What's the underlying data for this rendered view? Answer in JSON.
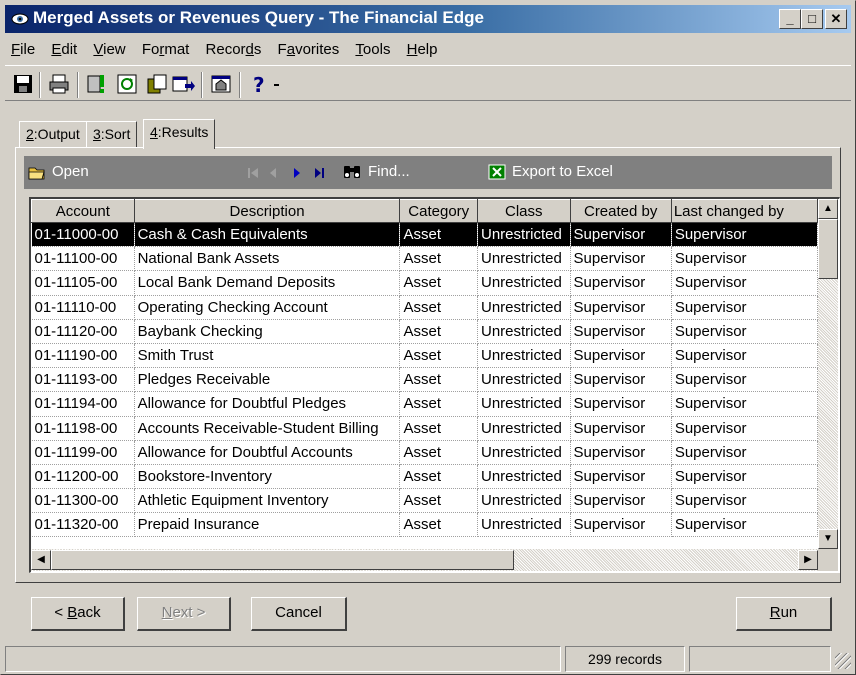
{
  "window": {
    "title": "Merged Assets or Revenues Query - The Financial Edge"
  },
  "menu": [
    {
      "pre": "",
      "u": "F",
      "post": "ile"
    },
    {
      "pre": "",
      "u": "E",
      "post": "dit"
    },
    {
      "pre": "",
      "u": "V",
      "post": "iew"
    },
    {
      "pre": "Fo",
      "u": "r",
      "post": "mat"
    },
    {
      "pre": "Recor",
      "u": "d",
      "post": "s"
    },
    {
      "pre": "F",
      "u": "a",
      "post": "vorites"
    },
    {
      "pre": "",
      "u": "T",
      "post": "ools"
    },
    {
      "pre": "",
      "u": "H",
      "post": "elp"
    }
  ],
  "tabs": [
    {
      "num": "2",
      "label": ":Output"
    },
    {
      "num": "3",
      "label": ":Sort"
    },
    {
      "num": "4",
      "label": ":Results"
    }
  ],
  "gridbar": {
    "open": "Open",
    "find": "Find...",
    "export": "Export to Excel"
  },
  "grid": {
    "columns": [
      "Account",
      "Description",
      "Category",
      "Class",
      "Created by",
      "Last changed by"
    ],
    "rows": [
      [
        "01-11000-00",
        "Cash & Cash Equivalents",
        "Asset",
        "Unrestricted",
        "Supervisor",
        "Supervisor"
      ],
      [
        "01-11100-00",
        "National Bank Assets",
        "Asset",
        "Unrestricted",
        "Supervisor",
        "Supervisor"
      ],
      [
        "01-11105-00",
        "Local Bank Demand Deposits",
        "Asset",
        "Unrestricted",
        "Supervisor",
        "Supervisor"
      ],
      [
        "01-11110-00",
        "Operating Checking Account",
        "Asset",
        "Unrestricted",
        "Supervisor",
        "Supervisor"
      ],
      [
        "01-11120-00",
        "Baybank Checking",
        "Asset",
        "Unrestricted",
        "Supervisor",
        "Supervisor"
      ],
      [
        "01-11190-00",
        "Smith Trust",
        "Asset",
        "Unrestricted",
        "Supervisor",
        "Supervisor"
      ],
      [
        "01-11193-00",
        "Pledges Receivable",
        "Asset",
        "Unrestricted",
        "Supervisor",
        "Supervisor"
      ],
      [
        "01-11194-00",
        "Allowance for Doubtful Pledges",
        "Asset",
        "Unrestricted",
        "Supervisor",
        "Supervisor"
      ],
      [
        "01-11198-00",
        "Accounts Receivable-Student Billing",
        "Asset",
        "Unrestricted",
        "Supervisor",
        "Supervisor"
      ],
      [
        "01-11199-00",
        "Allowance for Doubtful Accounts",
        "Asset",
        "Unrestricted",
        "Supervisor",
        "Supervisor"
      ],
      [
        "01-11200-00",
        "Bookstore-Inventory",
        "Asset",
        "Unrestricted",
        "Supervisor",
        "Supervisor"
      ],
      [
        "01-11300-00",
        "Athletic Equipment Inventory",
        "Asset",
        "Unrestricted",
        "Supervisor",
        "Supervisor"
      ],
      [
        "01-11320-00",
        "Prepaid Insurance",
        "Asset",
        "Unrestricted",
        "Supervisor",
        "Supervisor"
      ]
    ]
  },
  "buttons": {
    "back": {
      "pre": "< ",
      "u": "B",
      "post": "ack"
    },
    "next": {
      "pre": "",
      "u": "N",
      "post": "ext >"
    },
    "cancel": "Cancel",
    "run": {
      "pre": "",
      "u": "R",
      "post": "un"
    }
  },
  "status": {
    "records": "299 records"
  }
}
